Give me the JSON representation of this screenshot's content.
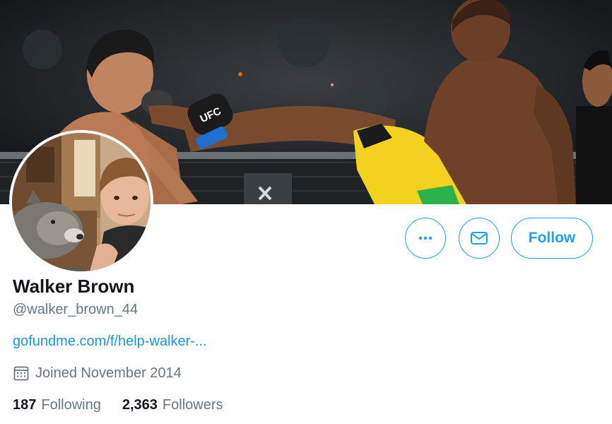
{
  "profile": {
    "display_name": "Walker Brown",
    "handle": "@walker_brown_44",
    "website": "gofundme.com/f/help-walker-...",
    "joined": "Joined November 2014"
  },
  "stats": {
    "following_count": "187",
    "following_label": "Following",
    "followers_count": "2,363",
    "followers_label": "Followers"
  },
  "actions": {
    "more_icon": "more-horizontal-icon",
    "message_icon": "envelope-icon",
    "follow_label": "Follow"
  },
  "banner": {
    "glove_text": "UFC"
  },
  "icons": {
    "joined": "calendar-icon"
  },
  "colors": {
    "accent": "#1da1f2",
    "link": "#1b95e0",
    "text_primary": "#14171a",
    "text_secondary": "#657786"
  }
}
